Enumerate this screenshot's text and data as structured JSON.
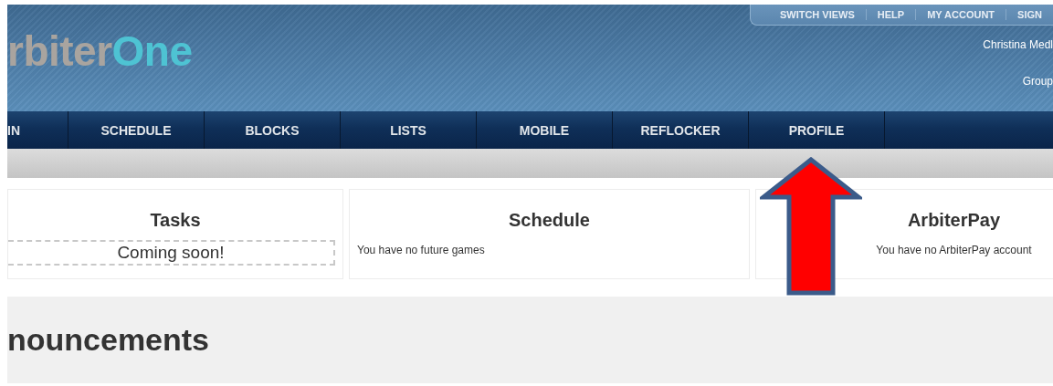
{
  "header": {
    "logo": {
      "parts": [
        "rbiter",
        "One"
      ]
    },
    "top_links": [
      "SWITCH VIEWS",
      "HELP",
      "MY ACCOUNT",
      "SIGN"
    ],
    "user_name": "Christina Medl",
    "group": "Group"
  },
  "nav": {
    "items": [
      {
        "label": "IN"
      },
      {
        "label": "SCHEDULE"
      },
      {
        "label": "BLOCKS"
      },
      {
        "label": "LISTS"
      },
      {
        "label": "MOBILE"
      },
      {
        "label": "REFLOCKER"
      },
      {
        "label": "PROFILE"
      }
    ]
  },
  "cards": [
    {
      "kind": "dashed",
      "title": "Tasks",
      "text": "Coming soon!"
    },
    {
      "kind": "left",
      "title": "Schedule",
      "text": "You have no future games"
    },
    {
      "kind": "center",
      "title": "ArbiterPay",
      "text": "You have no ArbiterPay account"
    }
  ],
  "announcements": {
    "title": "nouncements"
  }
}
